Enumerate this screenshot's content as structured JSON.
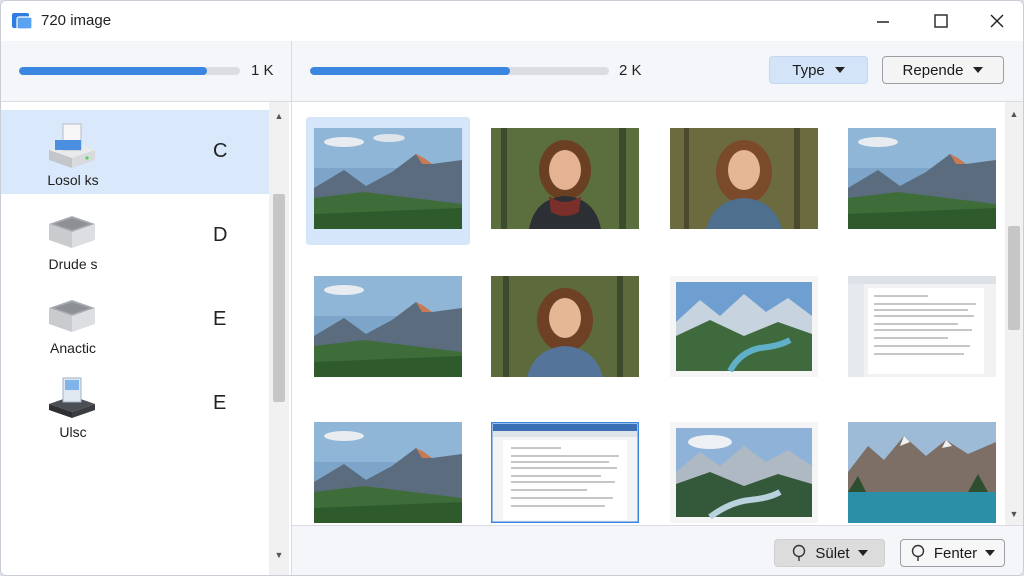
{
  "window": {
    "title": "720 image"
  },
  "left_pane": {
    "progress_percent": 85,
    "capacity_label": "1 K",
    "drives": [
      {
        "label": "Losol ks",
        "letter": "C",
        "icon": "drive-open-icon",
        "selected": true
      },
      {
        "label": "Drude s",
        "letter": "D",
        "icon": "drive-icon",
        "selected": false
      },
      {
        "label": "Anactic",
        "letter": "E",
        "icon": "drive-icon",
        "selected": false
      },
      {
        "label": "Ulsc",
        "letter": "E",
        "icon": "usb-drive-icon",
        "selected": false
      }
    ]
  },
  "right_pane": {
    "progress_percent": 67,
    "capacity_label": "2 K",
    "type_dropdown": "Type",
    "sort_dropdown": "Repende",
    "thumbnails": [
      {
        "kind": "landscape-photo",
        "selected": true
      },
      {
        "kind": "portrait-photo-scarf"
      },
      {
        "kind": "portrait-photo"
      },
      {
        "kind": "landscape-photo"
      },
      {
        "kind": "landscape-photo"
      },
      {
        "kind": "portrait-photo"
      },
      {
        "kind": "mountain-river-print"
      },
      {
        "kind": "document-screenshot"
      },
      {
        "kind": "landscape-photo"
      },
      {
        "kind": "document-screenshot",
        "selected_border": true
      },
      {
        "kind": "mountain-river-print"
      },
      {
        "kind": "lake-mountain-photo"
      }
    ]
  },
  "statusbar": {
    "select_label": "Sület",
    "filter_label": "Fenter"
  },
  "colors": {
    "accent": "#3b86e0",
    "selection": "#d9e8fb"
  }
}
